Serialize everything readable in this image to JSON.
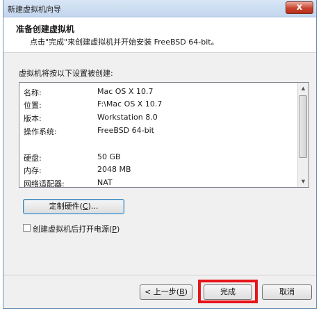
{
  "window": {
    "title": "新建虚拟机向导",
    "close_label": "x"
  },
  "header": {
    "title": "准备创建虚拟机",
    "subtitle": "点击\"完成\"来创建虚拟机并开始安装 FreeBSD 64-bit。"
  },
  "summary": {
    "label": "虚拟机将按以下设置被创建:",
    "rows": [
      {
        "key": "名称:",
        "value": "Mac OS X 10.7"
      },
      {
        "key": "位置:",
        "value": "F:\\Mac OS X 10.7"
      },
      {
        "key": "版本:",
        "value": "Workstation 8.0"
      },
      {
        "key": "操作系统:",
        "value": "FreeBSD 64-bit"
      },
      {
        "key": "",
        "value": ""
      },
      {
        "key": "硬盘:",
        "value": "50 GB"
      },
      {
        "key": "内存:",
        "value": "2048 MB"
      },
      {
        "key": "网络适配器:",
        "value": "NAT"
      }
    ]
  },
  "buttons": {
    "customize": {
      "text": "定制硬件(",
      "accel": "C",
      "tail": ")..."
    },
    "back": {
      "text": "< 上一步(",
      "accel": "B",
      "tail": ")"
    },
    "finish": "完成",
    "cancel": "取消"
  },
  "checkbox": {
    "text": "创建虚拟机后打开电源(",
    "accel": "P",
    "tail": ")",
    "checked": false
  },
  "colors": {
    "highlight": "#e6141a",
    "title_bar": "#c3d6ee"
  }
}
